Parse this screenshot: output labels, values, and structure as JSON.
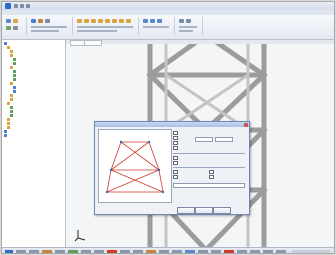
{
  "window": {
    "title": ""
  },
  "ribbon": {
    "tabs": [
      "",
      "",
      "",
      "",
      "",
      ""
    ]
  },
  "viewport": {
    "tabs": [
      "",
      ""
    ]
  },
  "tree": {
    "items": [
      "",
      "",
      "",
      "",
      "",
      "",
      "",
      "",
      "",
      "",
      "",
      "",
      "",
      "",
      "",
      "",
      "",
      "",
      "",
      "",
      "",
      "",
      "",
      ""
    ]
  },
  "dialog": {
    "title": "",
    "options": [
      "",
      "",
      "",
      "",
      "",
      "",
      "",
      "",
      "",
      ""
    ],
    "buttons": [
      "",
      "",
      ""
    ]
  },
  "colors": {
    "accent": "#2e6bc6",
    "structure": "#9a9a9a",
    "preview_lines": "#d03a2a",
    "dialog_border": "#6f87b4"
  },
  "icons": [
    "app-icon",
    "save-icon",
    "undo-icon",
    "redo-icon",
    "axis-icon",
    "close-icon"
  ]
}
